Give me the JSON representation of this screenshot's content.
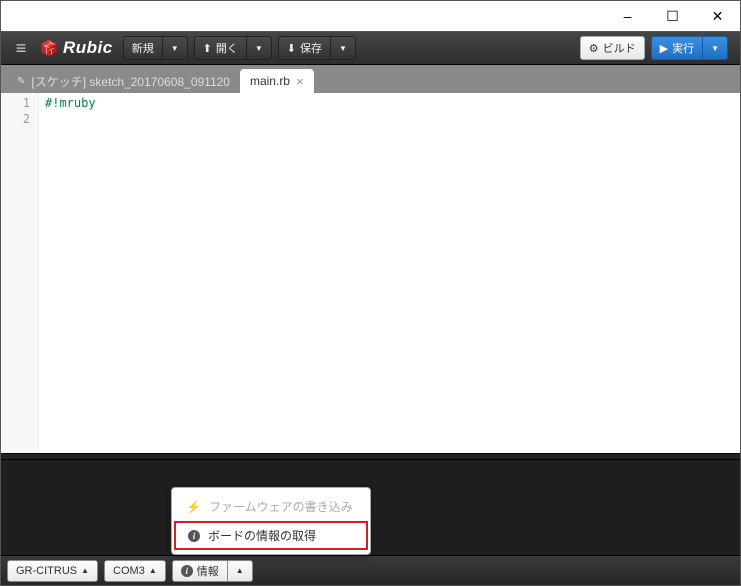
{
  "window": {
    "minimize": "–",
    "maximize": "☐",
    "close": "✕"
  },
  "app": {
    "name": "Rubic"
  },
  "toolbar": {
    "new": "新規",
    "open": "開く",
    "save": "保存",
    "build": "ビルド",
    "run": "実行"
  },
  "tabs": {
    "sketch": "[スケッチ] sketch_20170608_091120",
    "main": "main.rb"
  },
  "editor": {
    "lines": [
      "1",
      "2"
    ],
    "code": "#!mruby"
  },
  "popup": {
    "firmware": "ファームウェアの書き込み",
    "boardinfo": "ボードの情報の取得"
  },
  "status": {
    "board": "GR-CITRUS",
    "port": "COM3",
    "info": "情報"
  }
}
